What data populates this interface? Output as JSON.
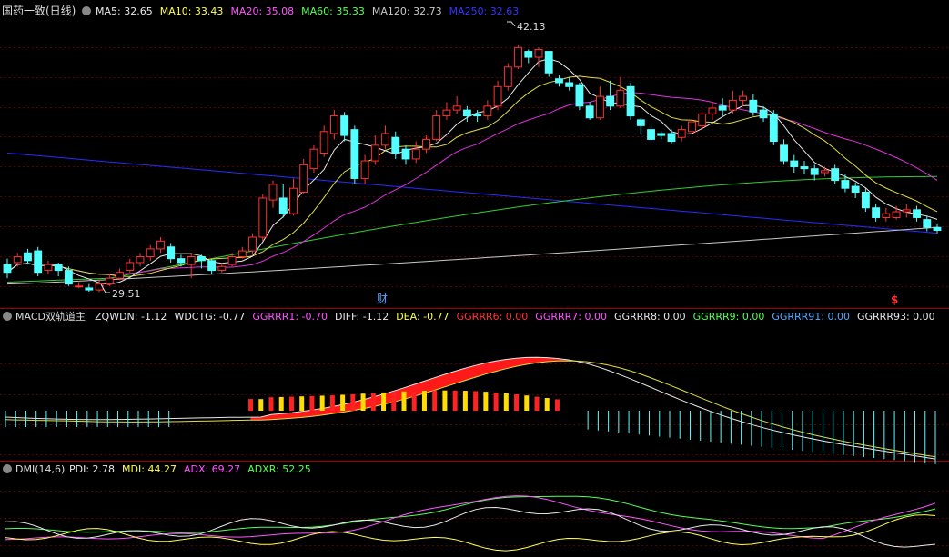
{
  "panels": {
    "main": {
      "stock_name": "国药一致(日线)",
      "indicators": [
        {
          "label": "MA5: 32.65",
          "color": "#e8e8e8"
        },
        {
          "label": "MA10: 33.43",
          "color": "#ffff55"
        },
        {
          "label": "MA20: 35.08",
          "color": "#ff55ff"
        },
        {
          "label": "MA60: 35.33",
          "color": "#55ff55"
        },
        {
          "label": "MA120: 32.73",
          "color": "#c8c8c8"
        },
        {
          "label": "MA250: 32.63",
          "color": "#3333ff"
        }
      ],
      "high_label": "42.13",
      "low_label": "29.51",
      "marker_cai": "财",
      "marker_dollar": "$"
    },
    "macd": {
      "title": "MACD双轨道主",
      "indicators": [
        {
          "label": "ZQWDN: -1.12",
          "color": "#e8e8e8"
        },
        {
          "label": "WDCTG: -0.77",
          "color": "#e8e8e8"
        },
        {
          "label": "GGRRR1: -0.70",
          "color": "#ff55ff"
        },
        {
          "label": "DIFF: -1.12",
          "color": "#e8e8e8"
        },
        {
          "label": "DEA: -0.77",
          "color": "#ffff55"
        },
        {
          "label": "GGRRR6: 0.00",
          "color": "#ff3333"
        },
        {
          "label": "GGRRR7: 0.00",
          "color": "#ff55ff"
        },
        {
          "label": "GGRRR8: 0.00",
          "color": "#e8e8e8"
        },
        {
          "label": "GGRRR9: 0.00",
          "color": "#55ff55"
        },
        {
          "label": "GGRRR91: 0.00",
          "color": "#55aaff"
        },
        {
          "label": "GGRRR93: 0.00",
          "color": "#e8e8e8"
        }
      ]
    },
    "dmi": {
      "title": "DMI(14,6)",
      "indicators": [
        {
          "label": "PDI: 2.78",
          "color": "#e8e8e8"
        },
        {
          "label": "MDI: 44.27",
          "color": "#ffff55"
        },
        {
          "label": "ADX: 69.27",
          "color": "#ff55ff"
        },
        {
          "label": "ADXR: 52.25",
          "color": "#55ff55"
        }
      ]
    }
  },
  "chart_data": {
    "type": "candlestick",
    "candles": [
      [
        30.9,
        30.5,
        31.2,
        30.2
      ],
      [
        31.0,
        31.3,
        31.5,
        30.8
      ],
      [
        31.5,
        31.1,
        31.7,
        30.9
      ],
      [
        31.6,
        30.5,
        31.8,
        30.3
      ],
      [
        30.6,
        30.9,
        31.1,
        30.4
      ],
      [
        30.9,
        30.6,
        31.0,
        30.3
      ],
      [
        30.6,
        29.9,
        30.8,
        29.8
      ],
      [
        29.8,
        29.8,
        30.0,
        29.7
      ],
      [
        29.7,
        29.6,
        29.9,
        29.51
      ],
      [
        29.6,
        29.9,
        30.1,
        29.5
      ],
      [
        29.9,
        30.2,
        30.4,
        29.8
      ],
      [
        30.2,
        30.5,
        30.7,
        30.1
      ],
      [
        30.6,
        31.0,
        31.2,
        30.5
      ],
      [
        31.0,
        31.3,
        31.5,
        30.8
      ],
      [
        31.3,
        31.7,
        31.9,
        31.1
      ],
      [
        31.7,
        32.1,
        32.3,
        31.5
      ],
      [
        31.8,
        31.2,
        32.0,
        31.0
      ],
      [
        31.2,
        31.0,
        31.4,
        30.8
      ],
      [
        30.9,
        31.3,
        31.5,
        30.2
      ],
      [
        31.3,
        31.1,
        31.4,
        30.7
      ],
      [
        31.1,
        30.6,
        31.2,
        30.4
      ],
      [
        30.6,
        30.8,
        31.0,
        30.5
      ],
      [
        30.9,
        31.3,
        31.5,
        30.8
      ],
      [
        31.3,
        31.6,
        31.8,
        31.2
      ],
      [
        31.6,
        32.3,
        32.5,
        31.4
      ],
      [
        32.3,
        34.3,
        34.5,
        32.1
      ],
      [
        34.2,
        35.0,
        35.2,
        33.8
      ],
      [
        34.3,
        33.5,
        35.0,
        33.3
      ],
      [
        33.5,
        34.8,
        35.3,
        33.4
      ],
      [
        34.6,
        36.0,
        36.3,
        34.5
      ],
      [
        35.8,
        36.8,
        37.0,
        35.6
      ],
      [
        36.6,
        37.7,
        38.0,
        36.4
      ],
      [
        37.6,
        38.5,
        38.8,
        37.3
      ],
      [
        38.5,
        37.5,
        38.7,
        37.2
      ],
      [
        37.8,
        35.3,
        38.0,
        35.0
      ],
      [
        35.3,
        36.2,
        36.5,
        35.0
      ],
      [
        36.2,
        37.0,
        37.5,
        36.0
      ],
      [
        37.0,
        37.6,
        38.0,
        36.8
      ],
      [
        37.4,
        36.6,
        37.7,
        36.3
      ],
      [
        36.8,
        36.3,
        37.0,
        36.0
      ],
      [
        36.3,
        36.8,
        37.2,
        36.1
      ],
      [
        36.8,
        37.3,
        37.5,
        36.6
      ],
      [
        37.3,
        38.5,
        38.8,
        37.2
      ],
      [
        38.5,
        38.8,
        39.2,
        38.3
      ],
      [
        38.8,
        39.0,
        39.5,
        38.6
      ],
      [
        38.8,
        38.5,
        39.0,
        38.2
      ],
      [
        38.6,
        38.5,
        38.8,
        38.2
      ],
      [
        38.5,
        39.0,
        39.3,
        38.3
      ],
      [
        39.0,
        40.0,
        40.3,
        38.8
      ],
      [
        40.0,
        41.0,
        41.2,
        39.8
      ],
      [
        41.0,
        42.0,
        42.13,
        40.9
      ],
      [
        41.8,
        41.5,
        41.9,
        41.2
      ],
      [
        41.5,
        41.9,
        42.0,
        41.0
      ],
      [
        41.8,
        40.7,
        41.8,
        40.5
      ],
      [
        40.4,
        40.2,
        40.6,
        40.0
      ],
      [
        40.2,
        40.0,
        40.5,
        39.8
      ],
      [
        40.1,
        39.0,
        40.2,
        38.8
      ],
      [
        39.0,
        38.4,
        39.2,
        38.3
      ],
      [
        38.4,
        39.5,
        40.0,
        38.3
      ],
      [
        39.5,
        39.0,
        40.3,
        38.8
      ],
      [
        39.0,
        39.8,
        40.5,
        38.9
      ],
      [
        40.0,
        38.5,
        40.2,
        38.3
      ],
      [
        38.3,
        38.0,
        38.4,
        37.6
      ],
      [
        37.8,
        37.3,
        38.0,
        37.2
      ],
      [
        37.6,
        37.5,
        37.7,
        37.3
      ],
      [
        37.6,
        37.2,
        37.8,
        37.1
      ],
      [
        37.4,
        37.8,
        38.0,
        37.2
      ],
      [
        37.7,
        38.2,
        38.3,
        37.6
      ],
      [
        38.0,
        38.6,
        38.7,
        37.8
      ],
      [
        38.6,
        38.9,
        39.2,
        38.3
      ],
      [
        39.0,
        38.8,
        39.4,
        38.5
      ],
      [
        38.8,
        39.3,
        39.8,
        38.6
      ],
      [
        39.3,
        39.5,
        39.8,
        39.0
      ],
      [
        39.3,
        38.7,
        39.6,
        38.5
      ],
      [
        38.8,
        38.4,
        39.0,
        38.2
      ],
      [
        38.6,
        37.2,
        38.8,
        37.0
      ],
      [
        37.0,
        36.2,
        37.3,
        36.0
      ],
      [
        36.2,
        35.9,
        36.5,
        35.6
      ],
      [
        35.9,
        35.8,
        36.2,
        35.5
      ],
      [
        35.8,
        35.5,
        36.0,
        35.2
      ],
      [
        35.6,
        35.7,
        35.9,
        35.4
      ],
      [
        35.8,
        35.2,
        36.0,
        35.0
      ],
      [
        35.2,
        34.8,
        35.5,
        34.6
      ],
      [
        34.9,
        34.6,
        35.1,
        34.3
      ],
      [
        34.6,
        33.8,
        34.8,
        33.6
      ],
      [
        33.8,
        33.3,
        34.0,
        33.1
      ],
      [
        33.3,
        33.5,
        33.8,
        33.1
      ],
      [
        33.3,
        33.6,
        33.9,
        33.2
      ],
      [
        33.6,
        33.7,
        34.0,
        33.3
      ],
      [
        33.7,
        33.3,
        33.9,
        33.1
      ],
      [
        33.2,
        32.8,
        33.4,
        32.6
      ],
      [
        32.8,
        32.65,
        33.0,
        32.5
      ]
    ],
    "ylim": [
      29.0,
      43.5
    ],
    "marked_values": {
      "high": 42.13,
      "low": 29.51
    }
  }
}
